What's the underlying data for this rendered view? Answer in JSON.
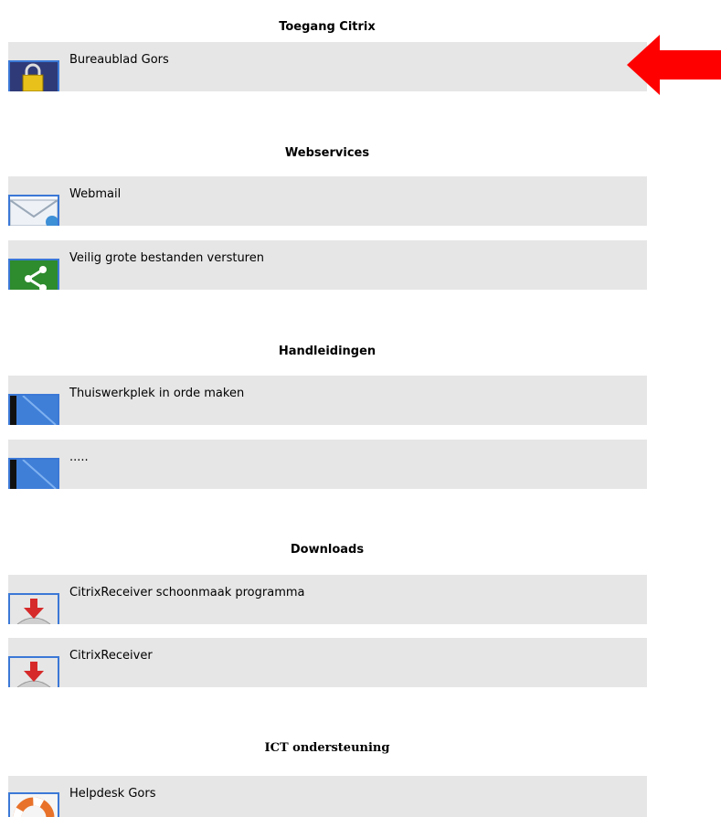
{
  "sections": [
    {
      "title": "Toegang Citrix",
      "items": [
        {
          "label": "Bureaublad Gors",
          "icon": "lock-icon"
        }
      ]
    },
    {
      "title": "Webservices",
      "items": [
        {
          "label": "Webmail",
          "icon": "mail-icon"
        },
        {
          "label": "Veilig grote bestanden versturen",
          "icon": "share-icon"
        }
      ]
    },
    {
      "title": "Handleidingen",
      "items": [
        {
          "label": "Thuiswerkplek in orde maken",
          "icon": "book-icon"
        },
        {
          "label": ".....",
          "icon": "book-icon"
        }
      ]
    },
    {
      "title": "Downloads",
      "items": [
        {
          "label": "CitrixReceiver schoonmaak programma",
          "icon": "download-icon"
        },
        {
          "label": "CitrixReceiver",
          "icon": "download-icon"
        }
      ]
    },
    {
      "title": "ICT ondersteuning",
      "items": [
        {
          "label": "Helpdesk Gors",
          "icon": "lifebuoy-icon"
        }
      ]
    }
  ],
  "annotation": {
    "icon": "red-arrow-left-icon",
    "color": "#ff0000"
  }
}
